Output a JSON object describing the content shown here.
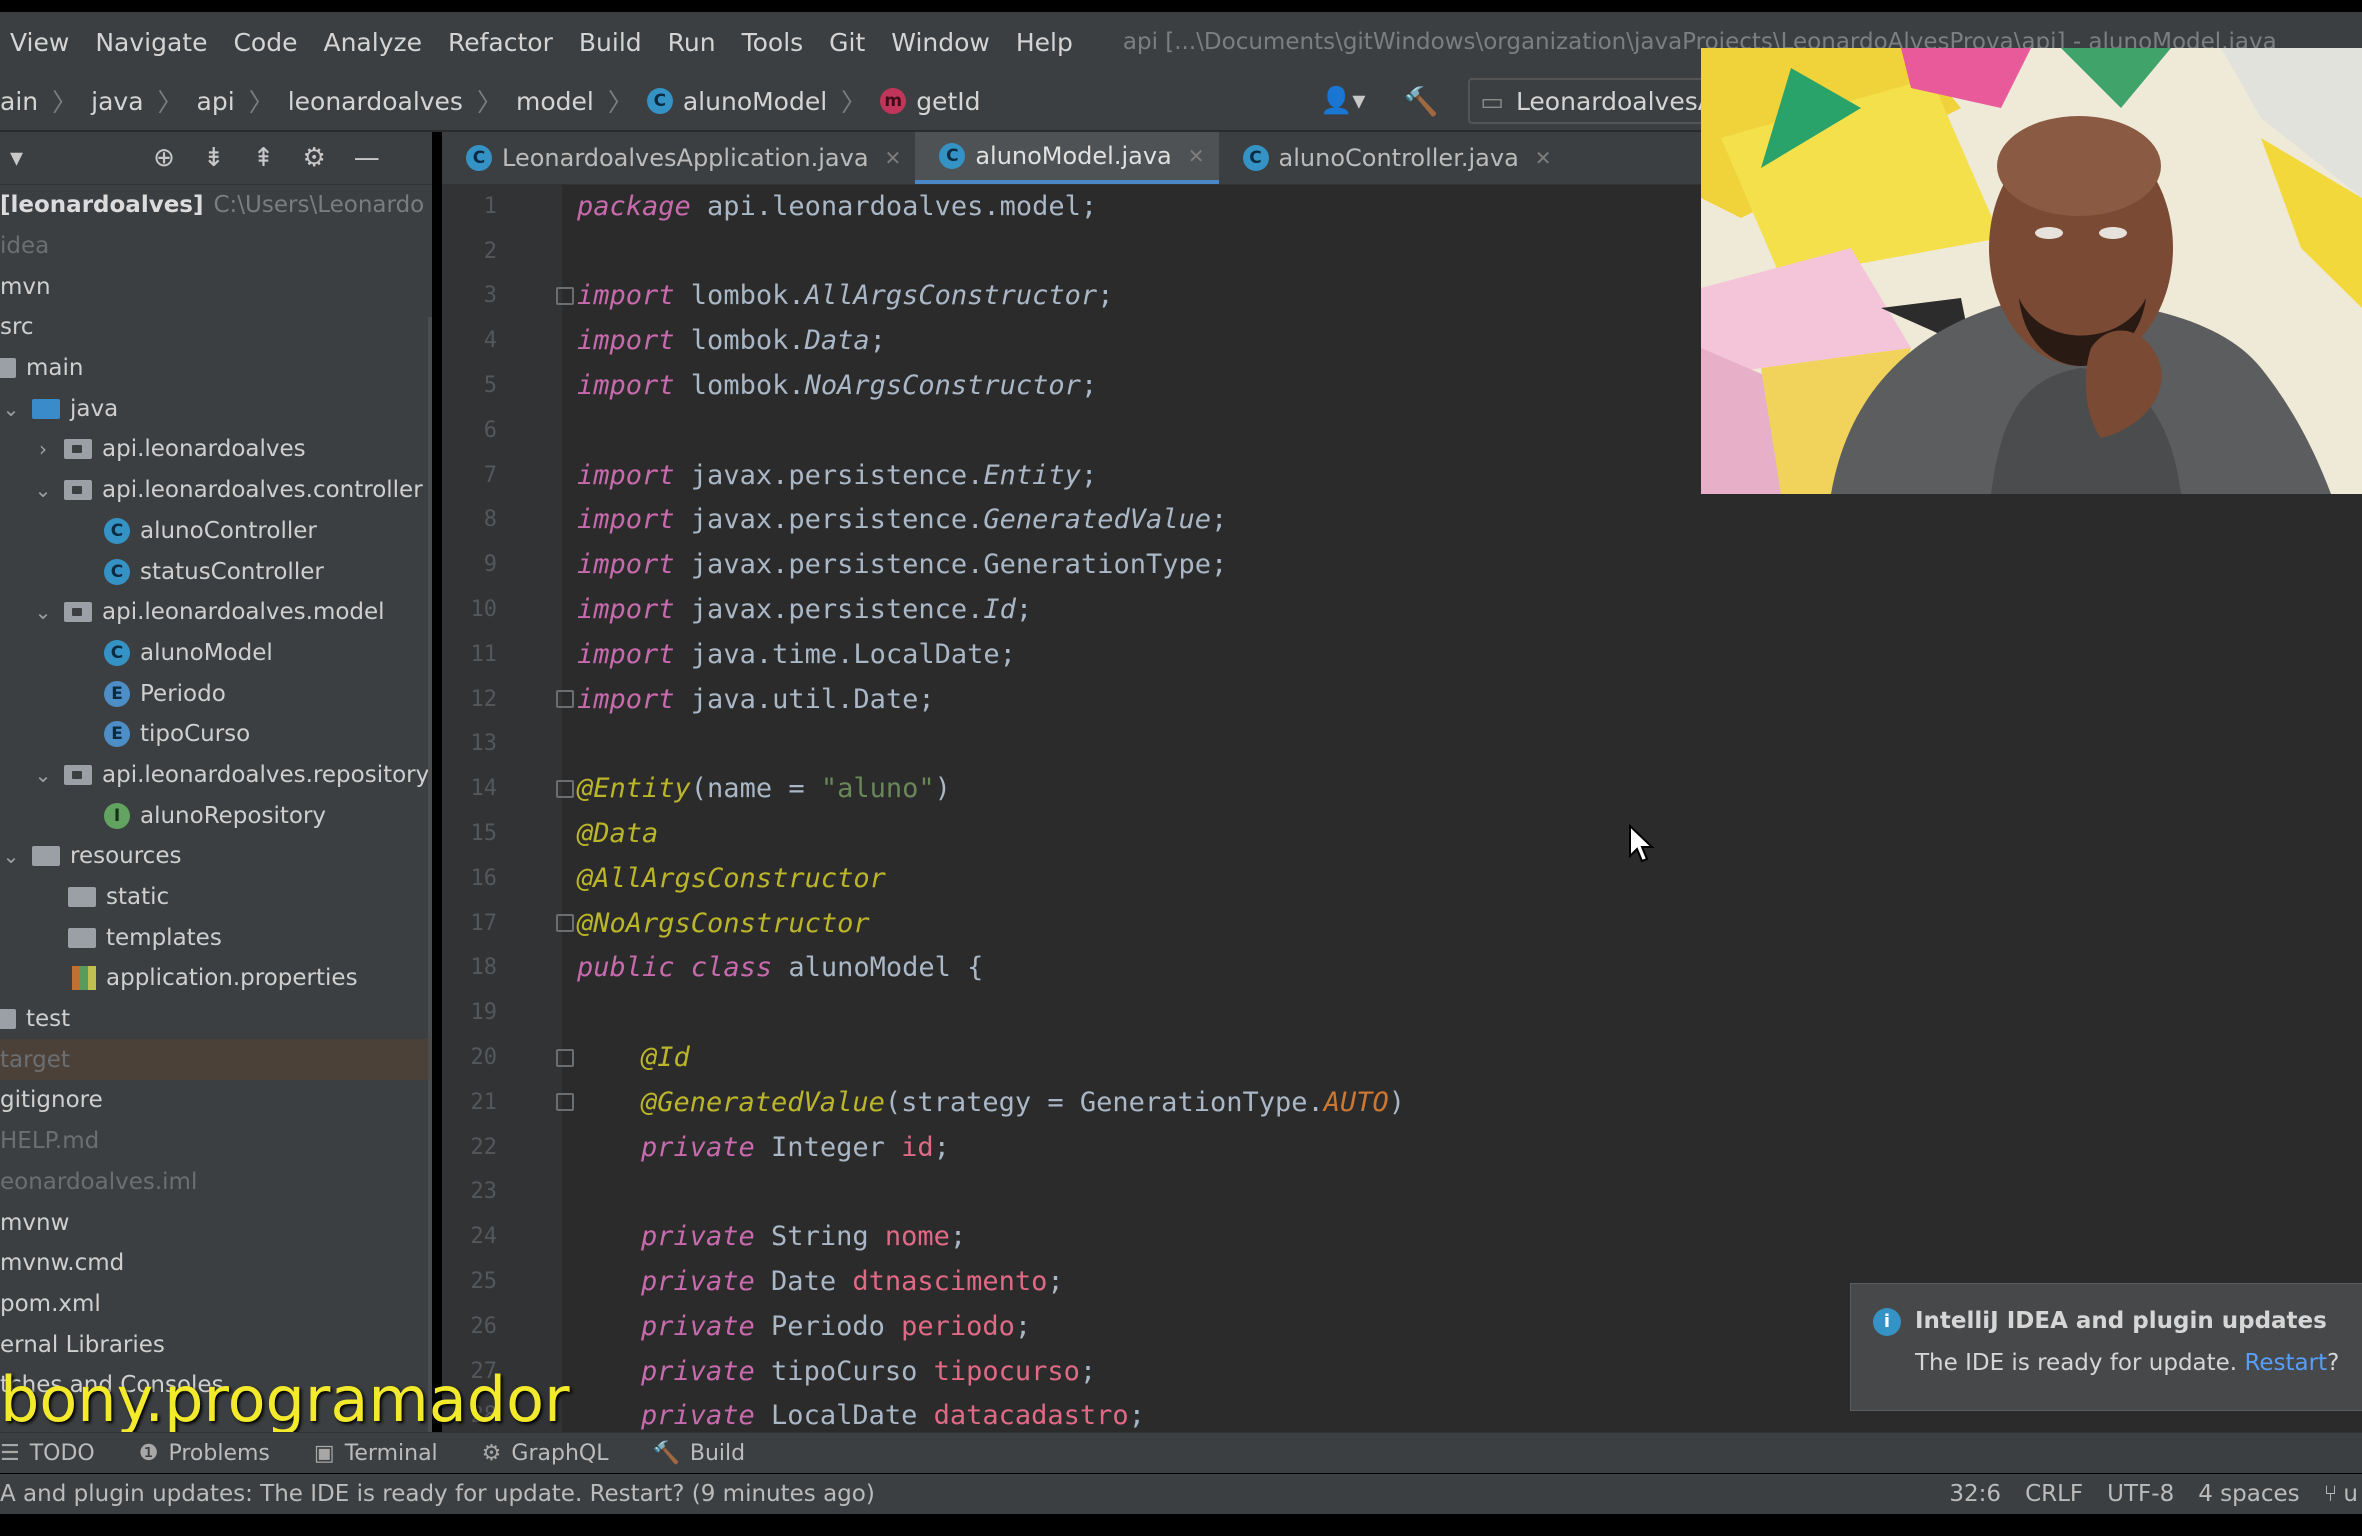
{
  "menu": [
    "View",
    "Navigate",
    "Code",
    "Analyze",
    "Refactor",
    "Build",
    "Run",
    "Tools",
    "Git",
    "Window",
    "Help"
  ],
  "window_path": "api [...\\Documents\\gitWindows\\organization\\javaProjects\\LeonardoAlvesProva\\api] - alunoModel.java",
  "breadcrumbs": [
    "ain",
    "java",
    "api",
    "leonardoalves",
    "model",
    "alunoModel",
    "getId"
  ],
  "run_config": "LeonardoalvesA",
  "project": {
    "root_label": "[leonardoalves]",
    "root_path": "C:\\Users\\Leonardo Alves",
    "items": [
      {
        "label": "idea"
      },
      {
        "label": "mvn"
      },
      {
        "label": "src"
      },
      {
        "label": "main"
      },
      {
        "label": "java"
      },
      {
        "label": "api.leonardoalves"
      },
      {
        "label": "api.leonardoalves.controller"
      },
      {
        "label": "alunoController"
      },
      {
        "label": "statusController"
      },
      {
        "label": "api.leonardoalves.model"
      },
      {
        "label": "alunoModel"
      },
      {
        "label": "Periodo"
      },
      {
        "label": "tipoCurso"
      },
      {
        "label": "api.leonardoalves.repository"
      },
      {
        "label": "alunoRepository"
      },
      {
        "label": "resources"
      },
      {
        "label": "static"
      },
      {
        "label": "templates"
      },
      {
        "label": "application.properties"
      },
      {
        "label": "test"
      },
      {
        "label": "target"
      },
      {
        "label": "gitignore"
      },
      {
        "label": "HELP.md"
      },
      {
        "label": "eonardoalves.iml"
      },
      {
        "label": "mvnw"
      },
      {
        "label": "mvnw.cmd"
      },
      {
        "label": "pom.xml"
      },
      {
        "label": "ernal Libraries"
      },
      {
        "label": "tches and Consoles"
      }
    ]
  },
  "tabs": [
    {
      "label": "LeonardoalvesApplication.java"
    },
    {
      "label": "alunoModel.java"
    },
    {
      "label": "alunoController.java"
    }
  ],
  "code": {
    "l1_kw": "package",
    "l1_rest": " api.leonardoalves.model;",
    "import_kw": "import",
    "l3_a": " lombok.",
    "l3_b": "AllArgsConstructor",
    "l3_c": ";",
    "l4_a": " lombok.",
    "l4_b": "Data",
    "l4_c": ";",
    "l5_a": " lombok.",
    "l5_b": "NoArgsConstructor",
    "l5_c": ";",
    "l7_a": " javax.persistence.",
    "l7_b": "Entity",
    "l7_c": ";",
    "l8_a": " javax.persistence.",
    "l8_b": "GeneratedValue",
    "l8_c": ";",
    "l9": " javax.persistence.GenerationType;",
    "l10_a": " javax.persistence.",
    "l10_b": "Id",
    "l10_c": ";",
    "l11": " java.time.LocalDate;",
    "l12": " java.util.Date;",
    "l14_ann": "@Entity",
    "l14_a": "(name = ",
    "l14_str": "\"aluno\"",
    "l14_b": ")",
    "l15": "@Data",
    "l16": "@AllArgsConstructor",
    "l17": "@NoArgsConstructor",
    "l18_kw1": "public",
    "l18_kw2": "class",
    "l18_rest": " alunoModel {",
    "l20": "@Id",
    "l21_ann": "@GeneratedValue",
    "l21_a": "(strategy = GenerationType.",
    "l21_b": "AUTO",
    "l21_c": ")",
    "private_kw": "private",
    "l22_t": " Integer ",
    "l22_f": "id",
    "l24_t": " String ",
    "l24_f": "nome",
    "l25_t": " Date ",
    "l25_f": "dtnascimento",
    "l26_t": " Periodo ",
    "l26_f": "periodo",
    "l27_t": " tipoCurso ",
    "l27_f": "tipocurso",
    "l28_t": " LocalDate ",
    "l28_f": "datacadastro",
    "semi": ";"
  },
  "notification": {
    "title": "IntelliJ IDEA and plugin updates",
    "body": "The IDE is ready for update.",
    "link": "Restart",
    "suffix": "?"
  },
  "watermark": "bony.programador",
  "tool_windows": [
    "TODO",
    "Problems",
    "Terminal",
    "GraphQL",
    "Build"
  ],
  "status": {
    "message": "A and plugin updates: The IDE is ready for update. Restart? (9 minutes ago)",
    "position": "32:6",
    "line_sep": "CRLF",
    "encoding": "UTF-8",
    "indent": "4 spaces",
    "vcs": "u"
  },
  "colors": {
    "accent": "#4a88c7",
    "keyword": "#cc7832",
    "annotation": "#bbb529",
    "field": "#e06a86",
    "watermark": "#f2ea2a"
  }
}
